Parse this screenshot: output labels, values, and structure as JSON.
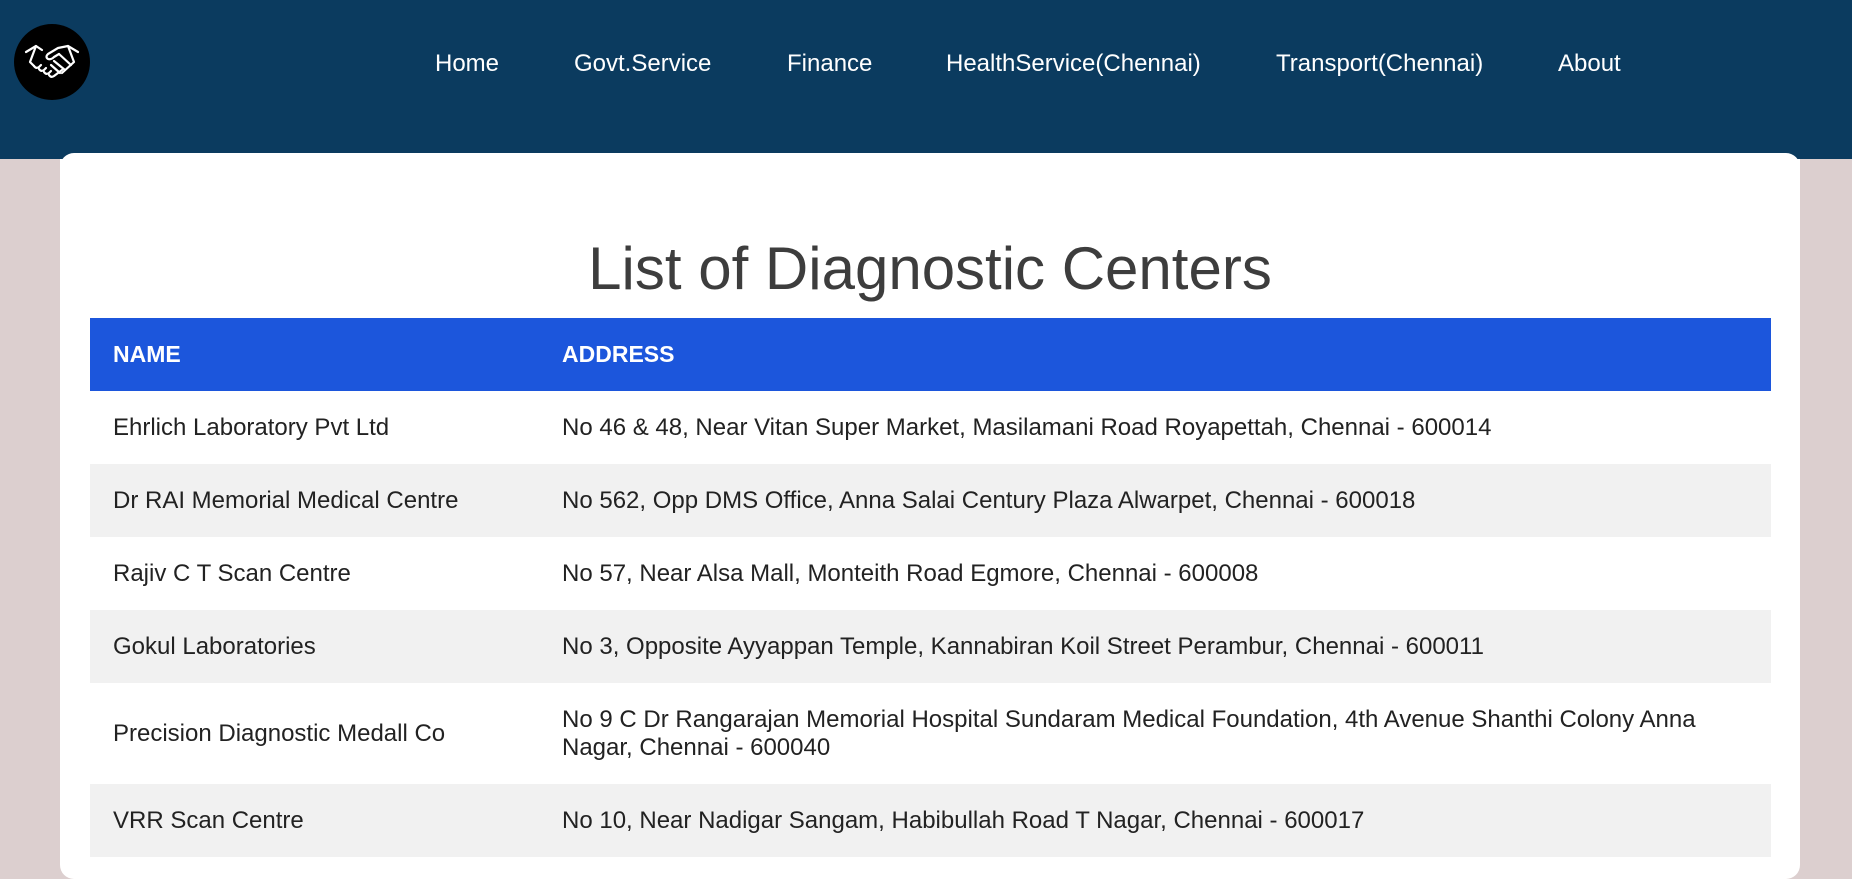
{
  "nav": {
    "items": [
      {
        "label": "Home"
      },
      {
        "label": "Govt.Service"
      },
      {
        "label": "Finance"
      },
      {
        "label": "HealthService(Chennai)"
      },
      {
        "label": "Transport(Chennai)"
      },
      {
        "label": "About"
      }
    ],
    "logo_icon": "handshake-icon"
  },
  "page": {
    "title": "List of Diagnostic Centers"
  },
  "table": {
    "headers": [
      "NAME",
      "ADDRESS"
    ],
    "rows": [
      {
        "name": "Ehrlich Laboratory Pvt Ltd",
        "address": "No 46 & 48, Near Vitan Super Market, Masilamani Road Royapettah, Chennai - 600014"
      },
      {
        "name": "Dr RAI Memorial Medical Centre",
        "address": "No 562, Opp DMS Office, Anna Salai Century Plaza Alwarpet, Chennai - 600018"
      },
      {
        "name": "Rajiv C T Scan Centre",
        "address": "No 57, Near Alsa Mall, Monteith Road Egmore, Chennai - 600008"
      },
      {
        "name": "Gokul Laboratories",
        "address": "No 3, Opposite Ayyappan Temple, Kannabiran Koil Street Perambur, Chennai - 600011"
      },
      {
        "name": "Precision Diagnostic Medall Co",
        "address": "No 9 C Dr Rangarajan Memorial Hospital Sundaram Medical Foundation, 4th Avenue Shanthi Colony Anna Nagar, Chennai - 600040"
      },
      {
        "name": "VRR Scan Centre",
        "address": "No 10, Near Nadigar Sangam, Habibullah Road T Nagar, Chennai - 600017"
      }
    ]
  },
  "colors": {
    "navbar": "#0b3b5f",
    "table_header": "#1c56dc",
    "page_background": "#dccfcf"
  }
}
